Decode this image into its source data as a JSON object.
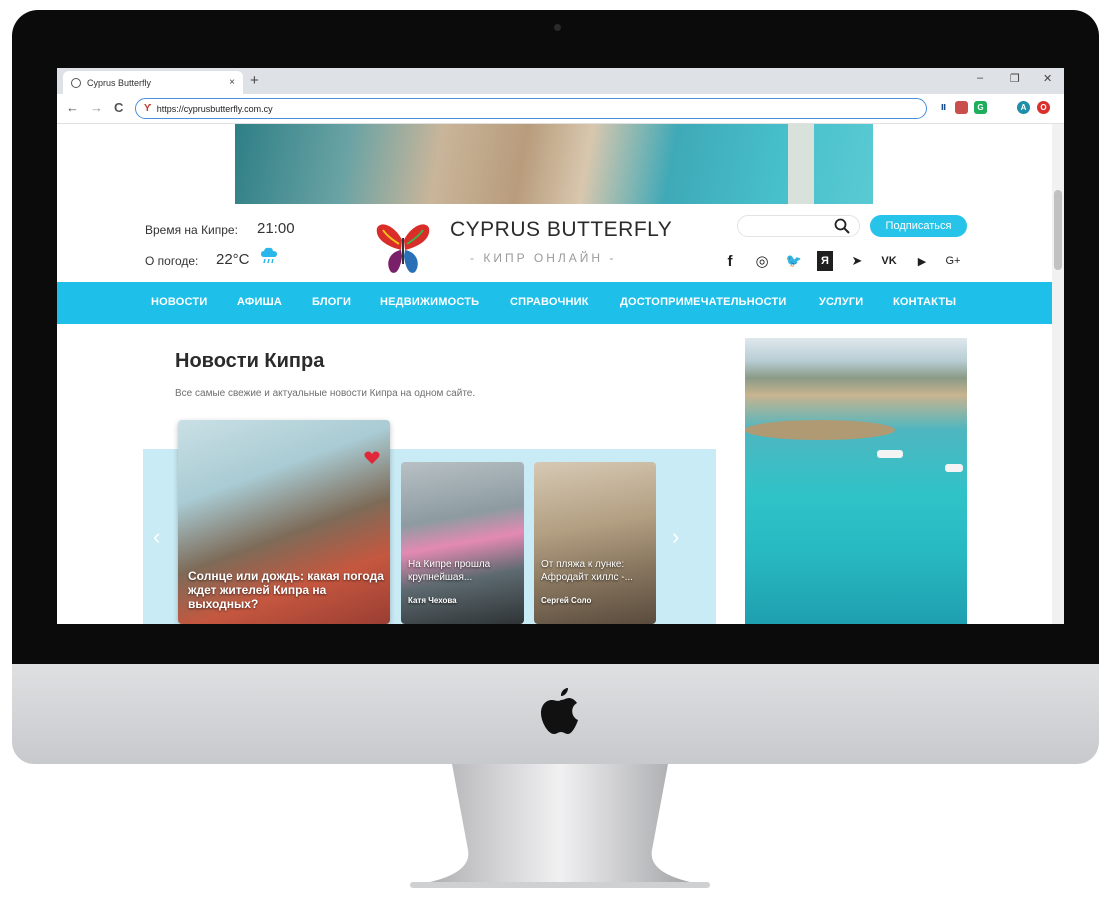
{
  "browser": {
    "tab_title": "Cyprus Butterfly",
    "tab_close": "×",
    "new_tab": "+",
    "url": "https://cyprusbutterfly.com.cy",
    "window_controls": [
      "–",
      "❐",
      "✕"
    ],
    "nav_controls": [
      "←",
      "→",
      "C"
    ]
  },
  "header": {
    "time_label": "Время на Кипре:",
    "time_value": "21:00",
    "weather_label": "О погоде:",
    "weather_value": "22°C",
    "logo_title": "CYPRUS BUTTERFLY",
    "logo_subtitle": "- КИПР ОНЛАЙН -",
    "subscribe_label": "Подписаться",
    "social_icons": [
      "facebook-icon",
      "instagram-icon",
      "twitter-icon",
      "yandex-icon",
      "telegram-icon",
      "vk-icon",
      "youtube-icon",
      "google-plus-icon"
    ],
    "social_glyphs": [
      "f",
      "◎",
      "🐦",
      "Я",
      "➤",
      "VK",
      "▶",
      "G+"
    ]
  },
  "nav": {
    "items": [
      "НОВОСТИ",
      "АФИША",
      "БЛОГИ",
      "НЕДВИЖИМОСТЬ",
      "СПРАВОЧНИК",
      "ДОСТОПРИМЕЧАТЕЛЬНОСТИ",
      "УСЛУГИ",
      "КОНТАКТЫ"
    ]
  },
  "news": {
    "title": "Новости Кипра",
    "subtitle": "Все самые свежие и актуальные новости Кипра на одном сайте.",
    "prev_arrow": "‹",
    "next_arrow": "›",
    "cards": [
      {
        "title": "Солнце или дождь: какая погода ждет жителей Кипра на выходных?",
        "author": ""
      },
      {
        "title": "На Кипре прошла крупнейшая...",
        "author": "Катя Чехова"
      },
      {
        "title": "От пляжа к лунке: Афродайт хиллс -...",
        "author": "Сергей Соло"
      }
    ]
  },
  "colors": {
    "accent": "#1ec0ea",
    "subscribe": "#28c3e9",
    "slider_bg": "#c9ebf6"
  }
}
